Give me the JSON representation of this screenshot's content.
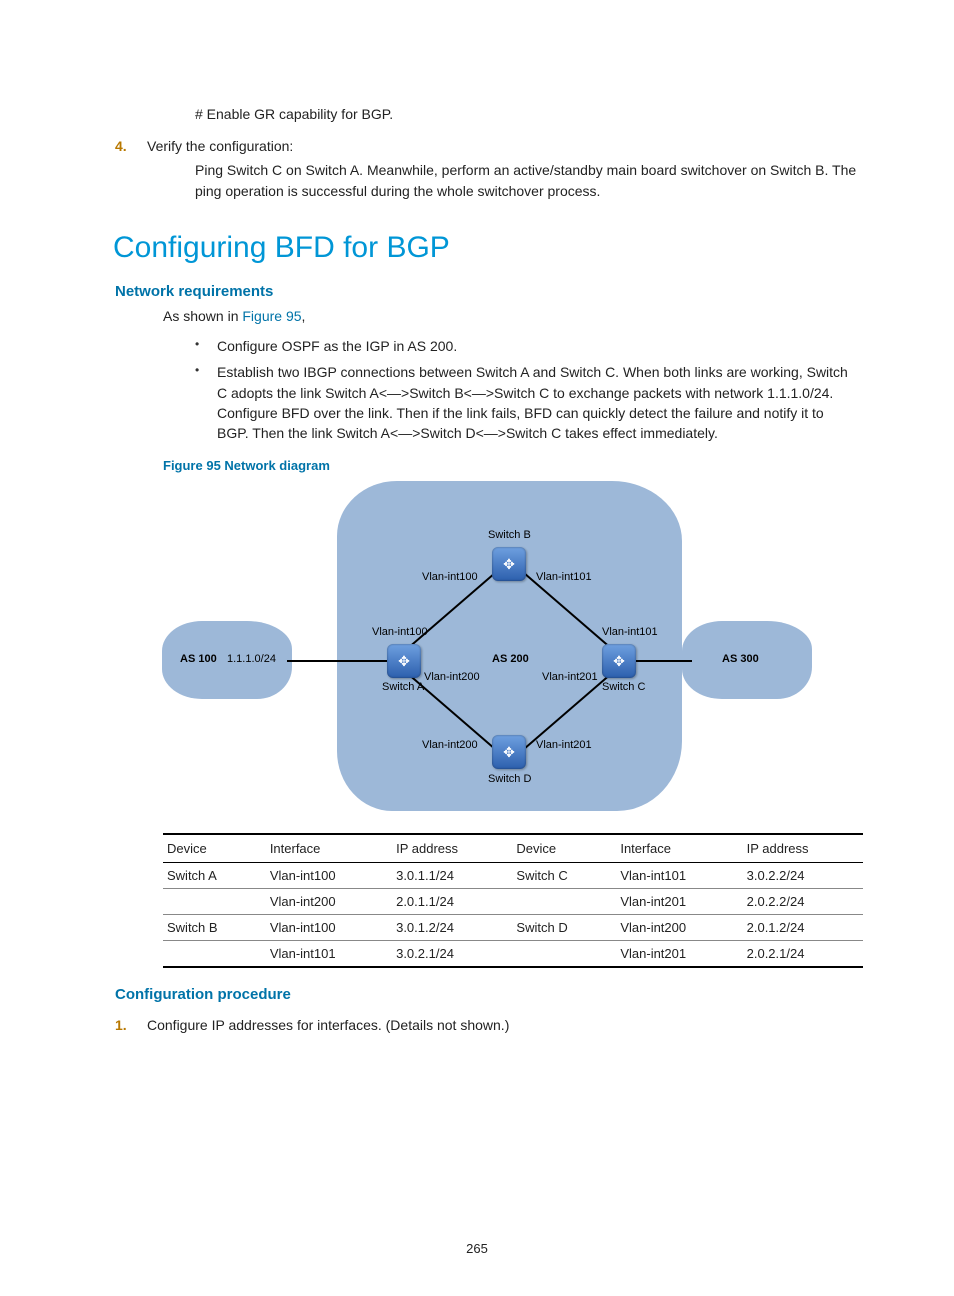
{
  "intro": {
    "enable_gr": "# Enable GR capability for BGP.",
    "step4_num": "4.",
    "step4_text": "Verify the configuration:",
    "step4_body": "Ping Switch C on Switch A. Meanwhile, perform an active/standby main board switchover on Switch B. The ping operation is successful during the whole switchover process."
  },
  "title": "Configuring BFD for BGP",
  "netreq": {
    "heading": "Network requirements",
    "intro_pre": "As shown in ",
    "intro_link": "Figure 95",
    "intro_post": ",",
    "bullet1": "Configure OSPF as the IGP in AS 200.",
    "bullet2": "Establish two IBGP connections between Switch A and Switch C. When both links are working, Switch C adopts the link Switch A<—>Switch B<—>Switch C to exchange packets with network 1.1.1.0/24. Configure BFD over the link. Then if the link fails, BFD can quickly detect the failure and notify it to BGP. Then the link Switch A<—>Switch D<—>Switch C takes effect immediately."
  },
  "figure_caption": "Figure 95 Network diagram",
  "diagram": {
    "as100": "AS 100",
    "as200": "AS 200",
    "as300": "AS 300",
    "net_100": "1.1.1.0/24",
    "switch_a": "Switch A",
    "switch_b": "Switch B",
    "switch_c": "Switch C",
    "switch_d": "Switch D",
    "vlan100_a": "Vlan-int100",
    "vlan100_b": "Vlan-int100",
    "vlan101_b": "Vlan-int101",
    "vlan101_c": "Vlan-int101",
    "vlan200_a": "Vlan-int200",
    "vlan200_d": "Vlan-int200",
    "vlan201_c": "Vlan-int201",
    "vlan201_d": "Vlan-int201"
  },
  "table": {
    "headers": [
      "Device",
      "Interface",
      "IP address",
      "Device",
      "Interface",
      "IP address"
    ],
    "rows": [
      [
        "Switch A",
        "Vlan-int100",
        "3.0.1.1/24",
        "Switch C",
        "Vlan-int101",
        "3.0.2.2/24"
      ],
      [
        "",
        "Vlan-int200",
        "2.0.1.1/24",
        "",
        "Vlan-int201",
        "2.0.2.2/24"
      ],
      [
        "Switch B",
        "Vlan-int100",
        "3.0.1.2/24",
        "Switch D",
        "Vlan-int200",
        "2.0.1.2/24"
      ],
      [
        "",
        "Vlan-int101",
        "3.0.2.1/24",
        "",
        "Vlan-int201",
        "2.0.2.1/24"
      ]
    ]
  },
  "config_proc": {
    "heading": "Configuration procedure",
    "step1_num": "1.",
    "step1_text": "Configure IP addresses for interfaces. (Details not shown.)"
  },
  "page_num": "265"
}
